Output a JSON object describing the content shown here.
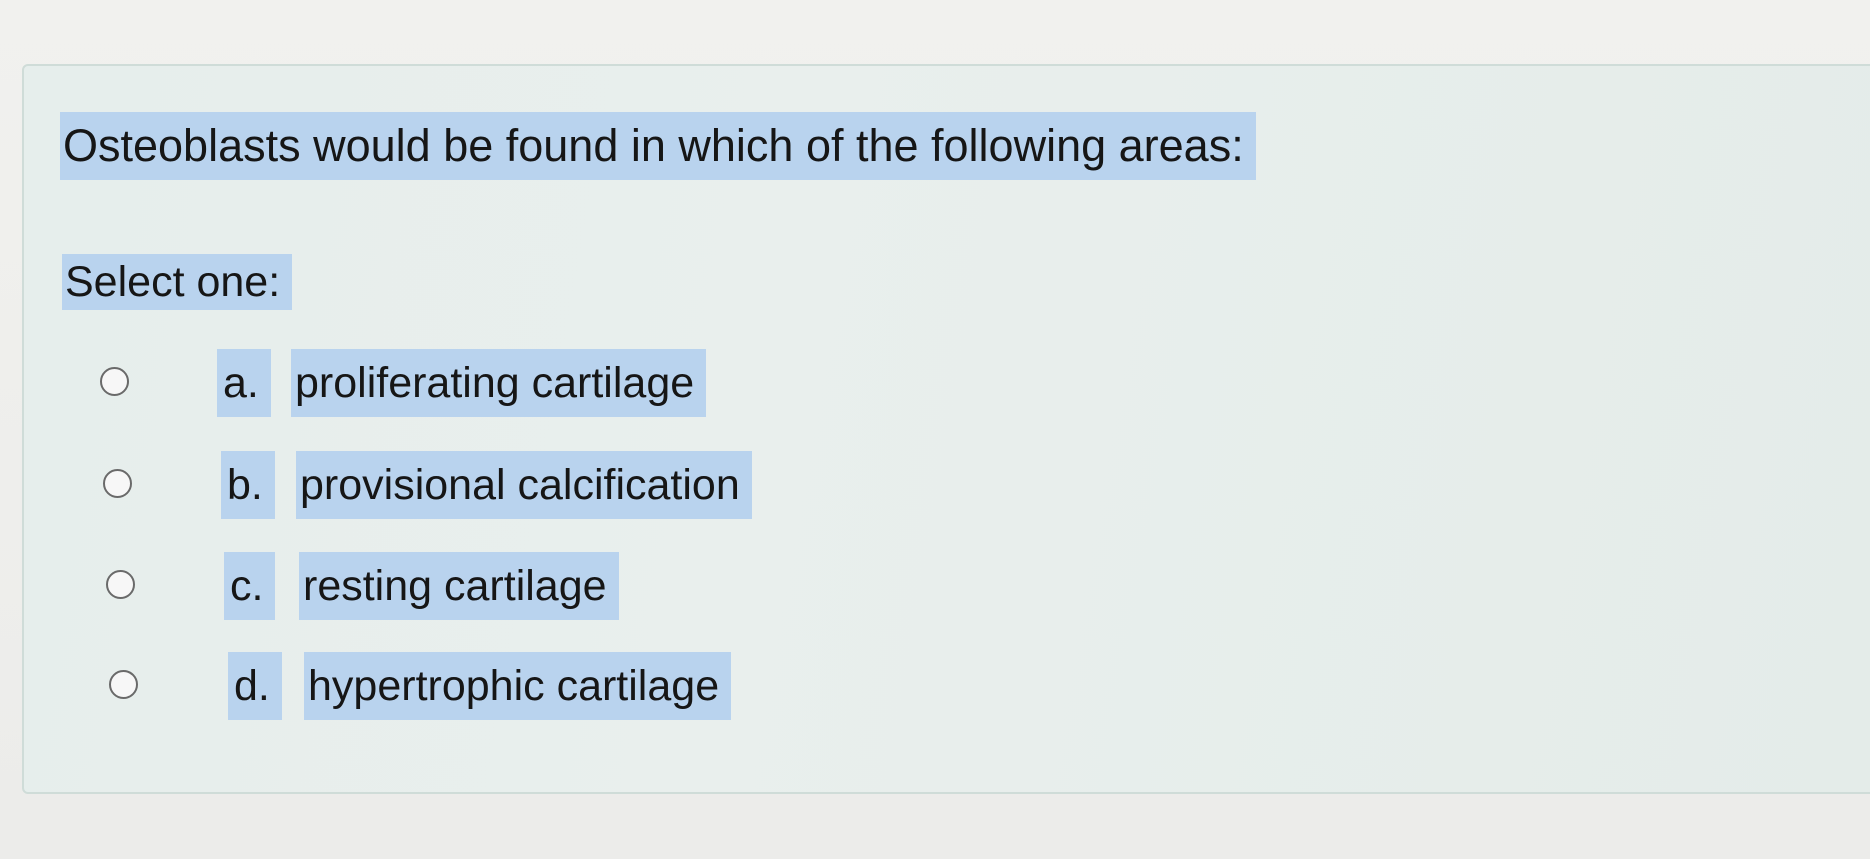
{
  "question": {
    "text": "Osteoblasts would be found in which of the following areas:",
    "prompt": "Select one:"
  },
  "answers": [
    {
      "letter": "a.",
      "text": "proliferating cartilage"
    },
    {
      "letter": "b.",
      "text": "provisional calcification"
    },
    {
      "letter": "c.",
      "text": "resting cartilage"
    },
    {
      "letter": "d.",
      "text": "hypertrophic cartilage"
    }
  ],
  "colors": {
    "highlight": "#b9d3ee",
    "card_background": "#e6eeec",
    "card_border": "#cfdcd8",
    "radio_border": "#6a6a6a"
  }
}
